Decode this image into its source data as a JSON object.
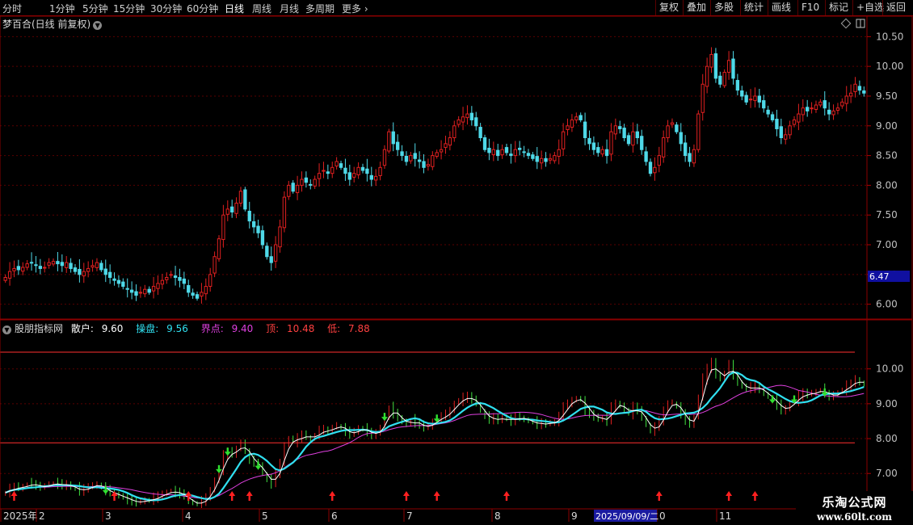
{
  "toolbar": {
    "periods": [
      "分时",
      "1分钟",
      "5分钟",
      "15分钟",
      "30分钟",
      "60分钟",
      "日线",
      "周线",
      "月线",
      "多周期"
    ],
    "active_period": "日线",
    "more_label": "更多",
    "tools": [
      "复权",
      "叠加",
      "多股",
      "统计",
      "画线",
      "F10",
      "标记",
      "+自选",
      "返回"
    ]
  },
  "main_chart": {
    "title": "梦百合(日线 前复权)",
    "current_price": "6.47",
    "y_ticks": [
      "10.50",
      "10.00",
      "9.50",
      "9.00",
      "8.50",
      "8.00",
      "7.50",
      "7.00",
      "6.50",
      "6.00"
    ]
  },
  "indicator": {
    "name": "股朋指标网",
    "sanhu_label": "散户:",
    "sanhu_value": "9.60",
    "caopan_label": "操盘:",
    "caopan_value": "9.56",
    "jiedian_label": "界点:",
    "jiedian_value": "9.40",
    "ding_label": "顶:",
    "ding_value": "10.48",
    "di_label": "低:",
    "di_value": "7.88",
    "y_ticks": [
      "10.00",
      "9.00",
      "8.00",
      "7.00"
    ]
  },
  "time_axis": {
    "labels": [
      "2025年",
      "2",
      "3",
      "4",
      "5",
      "6",
      "7",
      "8",
      "9",
      "0",
      "11"
    ],
    "cursor_date": "2025/09/09/二"
  },
  "watermark": {
    "line1": "乐淘公式网",
    "line2": "www.60lt.com"
  },
  "colors": {
    "up": "#e02020",
    "down": "#4fd9e8",
    "sanhu": "#ffffff",
    "caopan": "#30e0f0",
    "jiedian": "#e040e0",
    "ding": "#ff3030",
    "di": "#ff3030",
    "green_bar": "#40e040",
    "arrow_up": "#ff2020",
    "arrow_down": "#30e030"
  },
  "chart_data": {
    "type": "candlestick",
    "y_range": [
      5.9,
      10.6
    ],
    "indicator_y_range": [
      6.75,
      10.85
    ],
    "ding": 10.48,
    "di": 7.88,
    "close": [
      6.45,
      6.55,
      6.6,
      6.58,
      6.62,
      6.68,
      6.7,
      6.65,
      6.6,
      6.62,
      6.7,
      6.72,
      6.68,
      6.65,
      6.7,
      6.6,
      6.55,
      6.5,
      6.55,
      6.6,
      6.65,
      6.7,
      6.58,
      6.5,
      6.45,
      6.4,
      6.35,
      6.3,
      6.25,
      6.2,
      6.15,
      6.2,
      6.25,
      6.2,
      6.3,
      6.35,
      6.4,
      6.45,
      6.5,
      6.45,
      6.4,
      6.35,
      6.2,
      6.15,
      6.1,
      6.2,
      6.3,
      6.5,
      6.8,
      7.1,
      7.5,
      7.6,
      7.55,
      7.7,
      7.9,
      7.6,
      7.4,
      7.3,
      7.2,
      7.0,
      6.8,
      6.7,
      7.0,
      7.3,
      7.8,
      8.0,
      7.9,
      8.0,
      8.1,
      8.05,
      8.0,
      8.1,
      8.2,
      8.25,
      8.2,
      8.3,
      8.4,
      8.3,
      8.2,
      8.1,
      8.2,
      8.3,
      8.25,
      8.2,
      8.1,
      8.15,
      8.3,
      8.6,
      8.9,
      8.7,
      8.6,
      8.5,
      8.4,
      8.5,
      8.45,
      8.4,
      8.3,
      8.35,
      8.5,
      8.55,
      8.6,
      8.7,
      8.8,
      9.0,
      9.1,
      9.15,
      9.2,
      9.1,
      9.0,
      8.8,
      8.6,
      8.55,
      8.6,
      8.5,
      8.6,
      8.55,
      8.5,
      8.6,
      8.6,
      8.55,
      8.5,
      8.45,
      8.4,
      8.45,
      8.4,
      8.45,
      8.5,
      8.6,
      8.9,
      9.0,
      9.1,
      9.15,
      9.1,
      8.8,
      8.7,
      8.6,
      8.55,
      8.6,
      8.5,
      8.9,
      9.0,
      8.95,
      8.8,
      8.7,
      8.9,
      8.8,
      8.6,
      8.4,
      8.2,
      8.3,
      8.5,
      8.8,
      9.0,
      9.05,
      8.9,
      8.7,
      8.5,
      8.4,
      8.6,
      9.2,
      9.7,
      10.0,
      10.2,
      9.8,
      9.7,
      9.9,
      10.1,
      9.8,
      9.6,
      9.5,
      9.4,
      9.45,
      9.5,
      9.4,
      9.3,
      9.2,
      9.1,
      8.95,
      8.8,
      8.85,
      9.0,
      9.1,
      9.2,
      9.3,
      9.25,
      9.3,
      9.35,
      9.4,
      9.3,
      9.2,
      9.25,
      9.3,
      9.4,
      9.5,
      9.55,
      9.7,
      9.6,
      9.55
    ]
  }
}
